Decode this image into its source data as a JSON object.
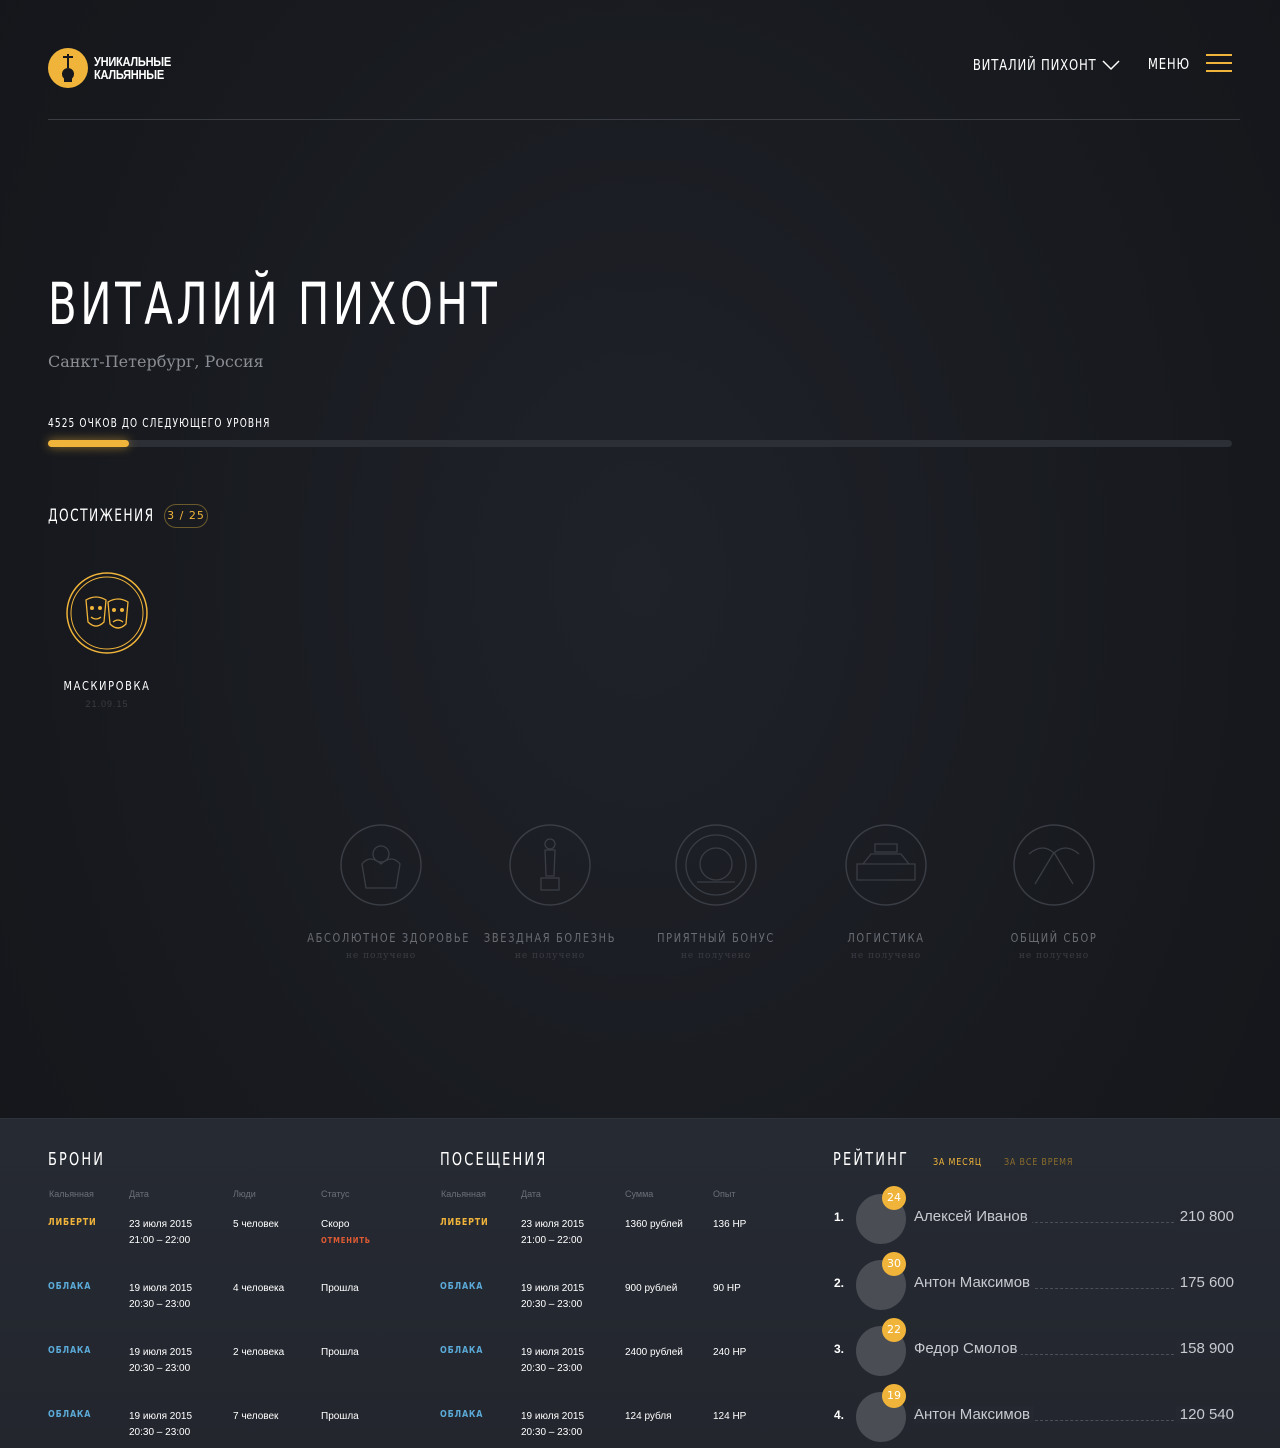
{
  "header": {
    "logo_line1": "УНИКАЛЬНЫЕ",
    "logo_line2": "КАЛЬЯННЫЕ",
    "user_name": "ВИТАЛИЙ ПИХОНТ",
    "menu_label": "МЕНЮ"
  },
  "profile": {
    "name": "ВИТАЛИЙ ПИХОНТ",
    "location": "Санкт-Петербург, Россия",
    "progress_label": "4525 ОЧКОВ ДО СЛЕДУЮЩЕГО УРОВНЯ",
    "progress_fraction": 0.068
  },
  "achievements": {
    "title": "ДОСТИЖЕНИЯ",
    "count": "3 / 25",
    "earned": [
      {
        "title": "МАСКИРОВКА",
        "date": "21.09.15",
        "icon": "theater-masks-icon"
      }
    ],
    "locked": [
      {
        "title": "АБСОЛЮТНОЕ ЗДОРОВЬЕ",
        "status": "не получено",
        "icon": "strongman-icon"
      },
      {
        "title": "ЗВЕЗДНАЯ БОЛЕЗНЬ",
        "status": "не получено",
        "icon": "oscar-statue-icon"
      },
      {
        "title": "ПРИЯТНЫЙ БОНУС",
        "status": "не получено",
        "icon": "coin-icon"
      },
      {
        "title": "ЛОГИСТИКА",
        "status": "не получено",
        "icon": "car-icon"
      },
      {
        "title": "ОБЩИЙ СБОР",
        "status": "не получено",
        "icon": "handshake-icon"
      }
    ]
  },
  "bookings": {
    "title": "БРОНИ",
    "headers": [
      "Кальянная",
      "Дата",
      "Люди",
      "Статус"
    ],
    "rows": [
      {
        "venue": "ЛИБЕРТИ",
        "date": "23 июля 2015",
        "time": "21:00 – 22:00",
        "people": "5 человек",
        "status": "Скоро",
        "action": "ОТМЕНИТЬ"
      },
      {
        "venue": "ОБЛАКА",
        "date": "19 июля 2015",
        "time": "20:30 – 23:00",
        "people": "4 человека",
        "status": "Прошла",
        "action": ""
      },
      {
        "venue": "ОБЛАКА",
        "date": "19 июля 2015",
        "time": "20:30 – 23:00",
        "people": "2 человека",
        "status": "Прошла",
        "action": ""
      },
      {
        "venue": "ОБЛАКА",
        "date": "19 июля 2015",
        "time": "20:30 – 23:00",
        "people": "7 человек",
        "status": "Прошла",
        "action": ""
      }
    ]
  },
  "visits": {
    "title": "ПОСЕЩЕНИЯ",
    "headers": [
      "Кальянная",
      "Дата",
      "Сумма",
      "Опыт"
    ],
    "rows": [
      {
        "venue": "ЛИБЕРТИ",
        "date": "23 июля 2015",
        "time": "21:00 – 22:00",
        "sum": "1360 рублей",
        "xp": "136 НР"
      },
      {
        "venue": "ОБЛАКА",
        "date": "19 июля 2015",
        "time": "20:30 – 23:00",
        "sum": "900 рублей",
        "xp": "90 НР"
      },
      {
        "venue": "ОБЛАКА",
        "date": "19 июля 2015",
        "time": "20:30 – 23:00",
        "sum": "2400 рублей",
        "xp": "240 НР"
      },
      {
        "venue": "ОБЛАКА",
        "date": "19 июля 2015",
        "time": "20:30 – 23:00",
        "sum": "124 рубля",
        "xp": "124 НР"
      }
    ]
  },
  "rating": {
    "title": "РЕЙТИНГ",
    "tabs": [
      "ЗА МЕСЯЦ",
      "ЗА ВСЕ ВРЕМЯ"
    ],
    "rows": [
      {
        "rank": "1.",
        "level": "24",
        "name": "Алексей Иванов",
        "score": "210 800"
      },
      {
        "rank": "2.",
        "level": "30",
        "name": "Антон Максимов",
        "score": "175 600"
      },
      {
        "rank": "3.",
        "level": "22",
        "name": "Федор Смолов",
        "score": "158 900"
      },
      {
        "rank": "4.",
        "level": "19",
        "name": "Антон Максимов",
        "score": "120 540"
      }
    ]
  },
  "colors": {
    "accent": "#f0b43a",
    "venue_liberty": "#f0b43a",
    "venue_oblaka": "#5aa9d6",
    "cancel": "#e35b32"
  }
}
